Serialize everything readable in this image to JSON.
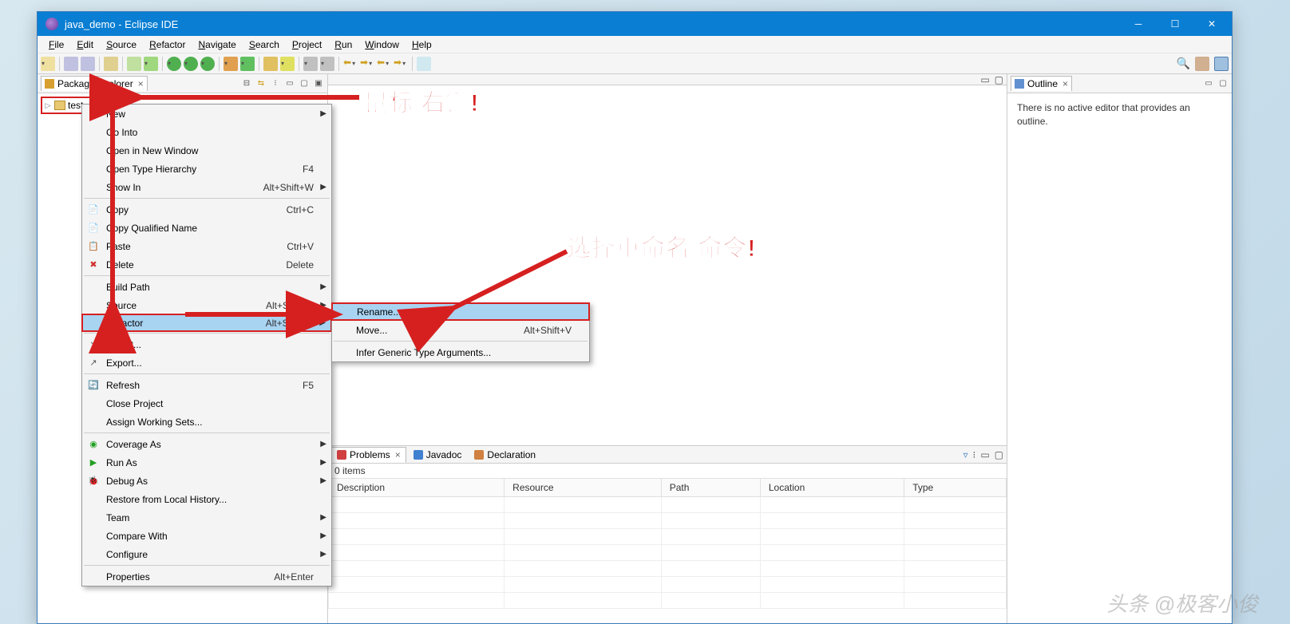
{
  "title": "java_demo - Eclipse IDE",
  "menubar": [
    "File",
    "Edit",
    "Source",
    "Refactor",
    "Navigate",
    "Search",
    "Project",
    "Run",
    "Window",
    "Help"
  ],
  "pkg_explorer": {
    "title": "Package Explorer",
    "project": "test_class"
  },
  "outline": {
    "title": "Outline",
    "empty": "There is no active editor that provides an outline."
  },
  "ctx1": [
    {
      "t": "item",
      "label": "New",
      "sub": true
    },
    {
      "t": "item",
      "label": "Go Into"
    },
    {
      "t": "item",
      "label": "Open in New Window"
    },
    {
      "t": "item",
      "label": "Open Type Hierarchy",
      "sc": "F4"
    },
    {
      "t": "item",
      "label": "Show In",
      "sc": "Alt+Shift+W",
      "sub": true
    },
    {
      "t": "sep"
    },
    {
      "t": "item",
      "label": "Copy",
      "sc": "Ctrl+C",
      "icon": "📄"
    },
    {
      "t": "item",
      "label": "Copy Qualified Name",
      "icon": "📄"
    },
    {
      "t": "item",
      "label": "Paste",
      "sc": "Ctrl+V",
      "icon": "📋"
    },
    {
      "t": "item",
      "label": "Delete",
      "sc": "Delete",
      "icon": "✖",
      "iconcolor": "#d03030"
    },
    {
      "t": "sep"
    },
    {
      "t": "item",
      "label": "Build Path",
      "sub": true
    },
    {
      "t": "item",
      "label": "Source",
      "sc": "Alt+Shift+S",
      "sub": true
    },
    {
      "t": "item",
      "label": "Refactor",
      "sc": "Alt+Shift+T",
      "sub": true,
      "hl": true
    },
    {
      "t": "sep"
    },
    {
      "t": "item",
      "label": "Import...",
      "icon": "↘"
    },
    {
      "t": "item",
      "label": "Export...",
      "icon": "↗"
    },
    {
      "t": "sep"
    },
    {
      "t": "item",
      "label": "Refresh",
      "sc": "F5",
      "icon": "🔄",
      "iconcolor": "#e0a020"
    },
    {
      "t": "item",
      "label": "Close Project"
    },
    {
      "t": "item",
      "label": "Assign Working Sets..."
    },
    {
      "t": "sep"
    },
    {
      "t": "item",
      "label": "Coverage As",
      "sub": true,
      "icon": "◉",
      "iconcolor": "#20a020"
    },
    {
      "t": "item",
      "label": "Run As",
      "sub": true,
      "icon": "▶",
      "iconcolor": "#20a020"
    },
    {
      "t": "item",
      "label": "Debug As",
      "sub": true,
      "icon": "🐞",
      "iconcolor": "#20a060"
    },
    {
      "t": "item",
      "label": "Restore from Local History..."
    },
    {
      "t": "item",
      "label": "Team",
      "sub": true
    },
    {
      "t": "item",
      "label": "Compare With",
      "sub": true
    },
    {
      "t": "item",
      "label": "Configure",
      "sub": true
    },
    {
      "t": "sep"
    },
    {
      "t": "item",
      "label": "Properties",
      "sc": "Alt+Enter"
    }
  ],
  "ctx2": [
    {
      "t": "item",
      "label": "Rename...",
      "hl": true
    },
    {
      "t": "item",
      "label": "Move...",
      "sc": "Alt+Shift+V"
    },
    {
      "t": "sep"
    },
    {
      "t": "item",
      "label": "Infer Generic Type Arguments..."
    }
  ],
  "problems": {
    "tabs": [
      {
        "label": "Problems",
        "icon": "#d04040"
      },
      {
        "label": "Javadoc",
        "icon": "#4080d0"
      },
      {
        "label": "Declaration",
        "icon": "#d08040"
      }
    ],
    "count": "0 items",
    "cols": [
      "Description",
      "Resource",
      "Path",
      "Location",
      "Type"
    ]
  },
  "annot1": "鼠标 右键!",
  "annot2": "选择重命名 命令!",
  "watermark": "头条 @极客小俊"
}
